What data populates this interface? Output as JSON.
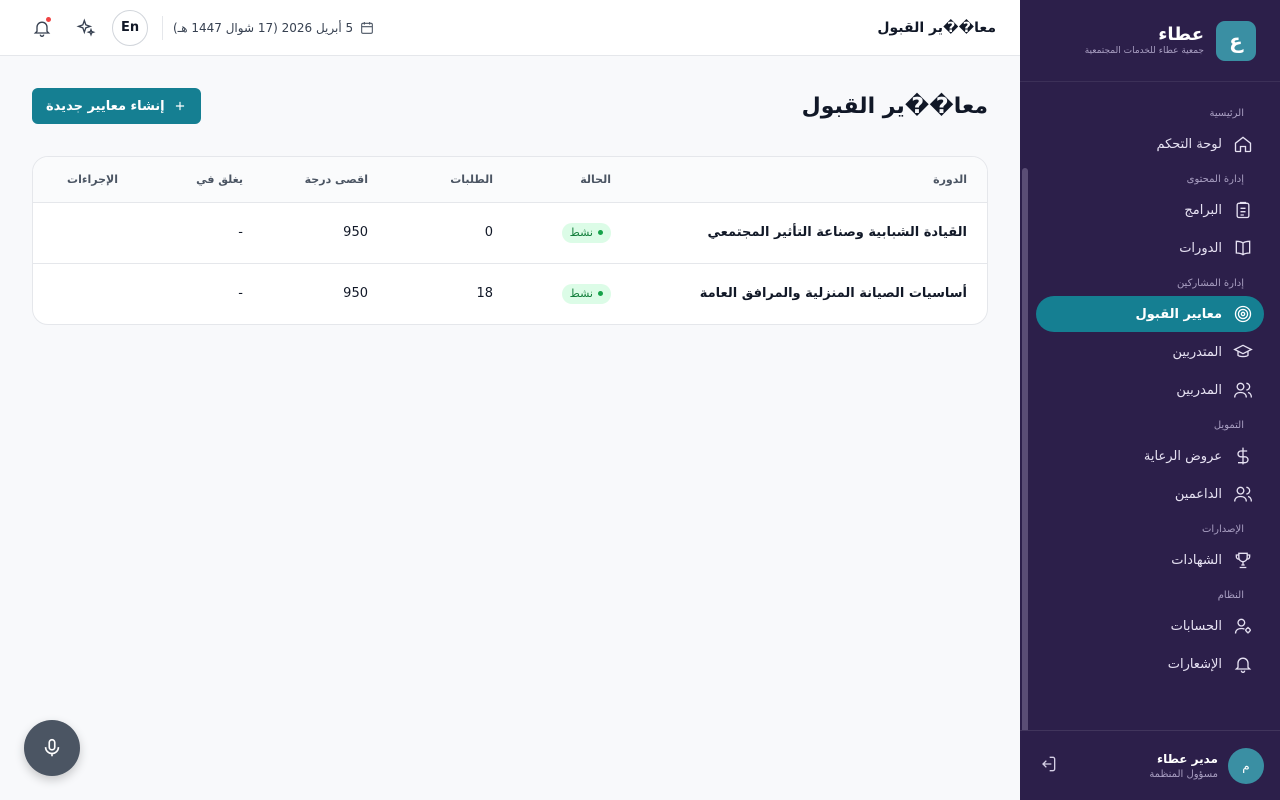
{
  "brand": {
    "logo_letter": "ع",
    "name": "عطاء",
    "subtitle": "جمعية عطاء للخدمات المجتمعية"
  },
  "sidebar": {
    "sections": [
      {
        "title": "الرئيسية",
        "items": [
          {
            "label": "لوحة التحكم",
            "icon": "home-icon"
          }
        ]
      },
      {
        "title": "إدارة المحتوى",
        "items": [
          {
            "label": "البرامج",
            "icon": "clipboard-icon"
          },
          {
            "label": "الدورات",
            "icon": "book-icon"
          }
        ]
      },
      {
        "title": "إدارة المشاركين",
        "items": [
          {
            "label": "معايير القبول",
            "icon": "target-icon",
            "active": true
          },
          {
            "label": "المتدربين",
            "icon": "graduation-cap-icon"
          },
          {
            "label": "المدربين",
            "icon": "users-icon"
          }
        ]
      },
      {
        "title": "التمويل",
        "items": [
          {
            "label": "عروض الرعاية",
            "icon": "dollar-icon"
          },
          {
            "label": "الداعمين",
            "icon": "users-icon"
          }
        ]
      },
      {
        "title": "الإصدارات",
        "items": [
          {
            "label": "الشهادات",
            "icon": "trophy-icon"
          }
        ]
      },
      {
        "title": "النظام",
        "items": [
          {
            "label": "الحسابات",
            "icon": "user-gear-icon"
          },
          {
            "label": "الإشعارات",
            "icon": "bell-icon"
          }
        ]
      }
    ]
  },
  "user": {
    "initial": "م",
    "name": "مدير عطاء",
    "role": "مسؤول المنظمة"
  },
  "topbar": {
    "title": "معا��ير القبول",
    "date": "5 أبريل 2026 (17 شوال 1447 هـ)",
    "lang": "En"
  },
  "page": {
    "title": "معا��ير القبول",
    "create_label": "إنشاء معايير جديدة"
  },
  "table": {
    "headers": {
      "course": "الدورة",
      "status": "الحالة",
      "applications": "الطلبات",
      "max_score": "اقصى درجة",
      "closes": "يغلق في",
      "actions": "الإجراءات"
    },
    "rows": [
      {
        "course": "القيادة الشبابية وصناعة التأثير المجتمعي",
        "status": "نشط",
        "applications": "0",
        "max_score": "950",
        "closes": "-",
        "actions": ""
      },
      {
        "course": "أساسيات الصيانة المنزلية والمرافق العامة",
        "status": "نشط",
        "applications": "18",
        "max_score": "950",
        "closes": "-",
        "actions": ""
      }
    ]
  },
  "colors": {
    "sidebar_bg": "#2c1f4a",
    "accent": "#157f92",
    "status_active": "#16a34a"
  }
}
